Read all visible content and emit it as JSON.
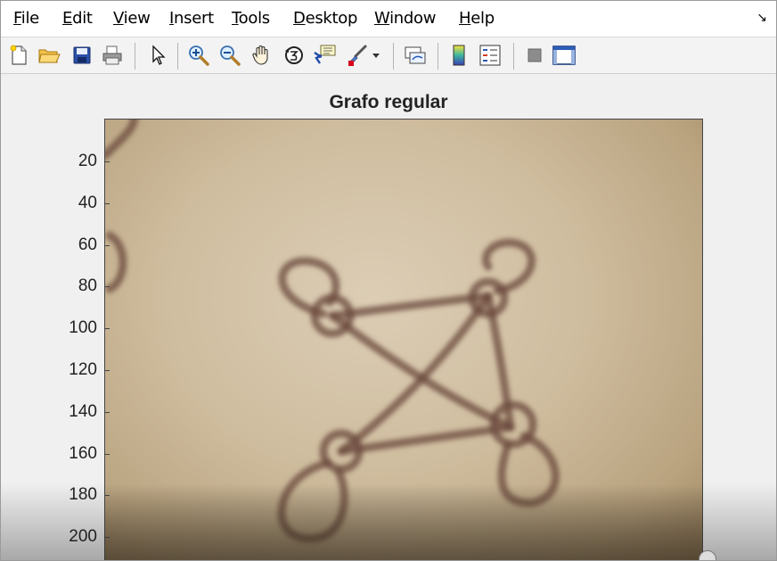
{
  "menubar": {
    "items": [
      {
        "label": "File",
        "mnemonic": "F",
        "rest": "ile"
      },
      {
        "label": "Edit",
        "mnemonic": "E",
        "rest": "dit"
      },
      {
        "label": "View",
        "mnemonic": "V",
        "rest": "iew"
      },
      {
        "label": "Insert",
        "mnemonic": "I",
        "rest": "nsert"
      },
      {
        "label": "Tools",
        "mnemonic": "T",
        "rest": "ools"
      },
      {
        "label": "Desktop",
        "mnemonic": "D",
        "rest": "esktop"
      },
      {
        "label": "Window",
        "mnemonic": "W",
        "rest": "indow"
      },
      {
        "label": "Help",
        "mnemonic": "H",
        "rest": "elp"
      }
    ],
    "dock_glyph": "↘"
  },
  "toolbar": {
    "icons": [
      "new-figure-icon",
      "open-file-icon",
      "save-icon",
      "print-icon",
      "select-arrow-icon",
      "zoom-in-icon",
      "zoom-out-icon",
      "pan-hand-icon",
      "rotate-3d-icon",
      "data-cursor-icon",
      "brush-icon",
      "link-plot-icon",
      "colorbar-icon",
      "legend-icon",
      "hide-plot-tools-icon",
      "show-plot-tools-icon"
    ]
  },
  "plot": {
    "title": "Grafo regular",
    "yticks": [
      "20",
      "40",
      "60",
      "80",
      "100",
      "120",
      "140",
      "160",
      "180",
      "200"
    ]
  },
  "colors": {
    "paper": "#d6c6aa",
    "ink": "#6b4a3e"
  }
}
